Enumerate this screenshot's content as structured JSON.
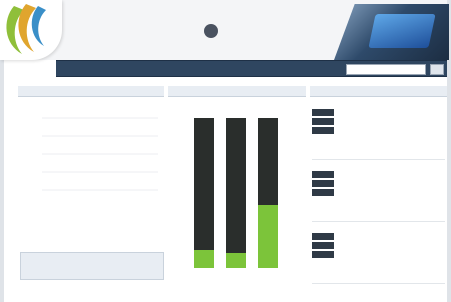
{
  "colors": {
    "nav_background": "#2f4660",
    "panel_title_background": "#e8edf3",
    "line_series": "#3aa87a",
    "bar_dark": "#2a2e2c",
    "bar_green": "#7cc43a",
    "link_red": "#c62828"
  },
  "icons": {
    "corner_logo": "crescent-logo-icon",
    "brand_mark": "emblem-icon",
    "search_button": "search-icon"
  },
  "header": {
    "brand_text": "",
    "brand_subtext": "",
    "red_links": [
      "",
      "",
      ""
    ]
  },
  "nav": {
    "items": [
      "",
      "",
      "",
      "",
      ""
    ],
    "search_placeholder": "",
    "search_button_label": ""
  },
  "left_panel": {
    "title": "",
    "chart_caption": "",
    "red_note": "",
    "subpanel_text": "",
    "footer_text": ""
  },
  "mid_panel": {
    "title": "",
    "subtitle": "",
    "legend": [
      "",
      "",
      "",
      ""
    ],
    "red_note": ""
  },
  "right_panel": {
    "title": "",
    "entries": [
      {
        "date": "",
        "fields": [
          {
            "key": "",
            "value": ""
          },
          {
            "key": "",
            "value": ""
          },
          {
            "key": "",
            "value": ""
          }
        ],
        "description": ""
      },
      {
        "date": "",
        "fields": [
          {
            "key": "",
            "value": ""
          },
          {
            "key": "",
            "value": ""
          },
          {
            "key": "",
            "value": ""
          }
        ],
        "description": ""
      },
      {
        "date": "",
        "fields": [
          {
            "key": "",
            "value": ""
          },
          {
            "key": "",
            "value": ""
          },
          {
            "key": "",
            "value": ""
          }
        ],
        "description": ""
      }
    ]
  },
  "chart_data": [
    {
      "type": "line",
      "title": "",
      "xlabel": "",
      "ylabel": "",
      "grid": true,
      "x": [],
      "series": [
        {
          "values": []
        }
      ]
    },
    {
      "type": "bar",
      "title": "",
      "stacked": true,
      "categories": [
        "",
        "",
        ""
      ],
      "ylim": [
        0,
        100
      ],
      "series": [
        {
          "values": [
            12,
            10,
            42
          ]
        },
        {
          "values": [
            88,
            90,
            58
          ]
        }
      ]
    }
  ]
}
